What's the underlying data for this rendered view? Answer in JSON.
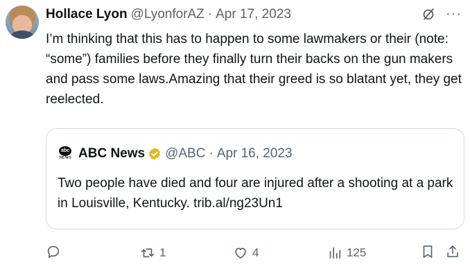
{
  "tweet": {
    "author_name": "Hollace Lyon",
    "author_handle": "@LyonforAZ",
    "separator": "·",
    "date": "Apr 17, 2023",
    "more_label": "···",
    "text": "I’m thinking that this has to happen to some lawmakers or their (note: “some”) families before they finally turn their backs on the gun makers and pass some laws.Amazing that their greed is so blatant yet, they get reelected."
  },
  "quote": {
    "logo_text": "abc",
    "logo_subtext": "NEWS",
    "author_name": "ABC News",
    "author_handle": "@ABC",
    "separator": "·",
    "date": "Apr 16, 2023",
    "text": "Two people have died and four are injured after a shooting at a park in Louisville, Kentucky. trib.al/ng23Un1",
    "verified_color": "#e2b719"
  },
  "actions": {
    "reply_count": "",
    "retweet_count": "1",
    "like_count": "4",
    "views_count": "125"
  },
  "icons": {
    "reply": "reply-icon",
    "retweet": "retweet-icon",
    "like": "heart-icon",
    "views": "views-icon",
    "bookmark": "bookmark-icon",
    "share": "share-icon",
    "grok": "grok-icon",
    "more": "more-icon",
    "verified": "verified-badge-icon"
  },
  "colors": {
    "text": "#0f1419",
    "secondary": "#536471",
    "border": "#cfd9de"
  }
}
